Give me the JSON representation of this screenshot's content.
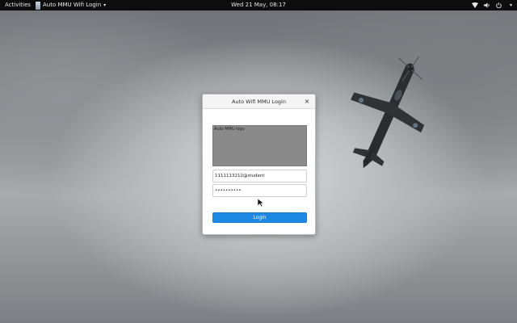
{
  "topbar": {
    "activities_label": "Activities",
    "app_menu_label": "Auto MMU Wifi Login",
    "clock": "Wed 21 May, 08:17"
  },
  "dialog": {
    "title": "Auto Wifi MMU Login",
    "close_glyph": "×",
    "logo_text": "Auto MMU logo",
    "username_value": "1111113212@student",
    "password_value": "••••••••••",
    "login_label": "Login"
  },
  "colors": {
    "topbar": "#0d0d0d",
    "accent": "#1e88e5",
    "logo_placeholder": "#8a8a8a"
  },
  "icons": [
    "app-icon",
    "network-icon",
    "volume-icon",
    "power-icon",
    "chevron-down-icon",
    "mouse-cursor-icon"
  ]
}
